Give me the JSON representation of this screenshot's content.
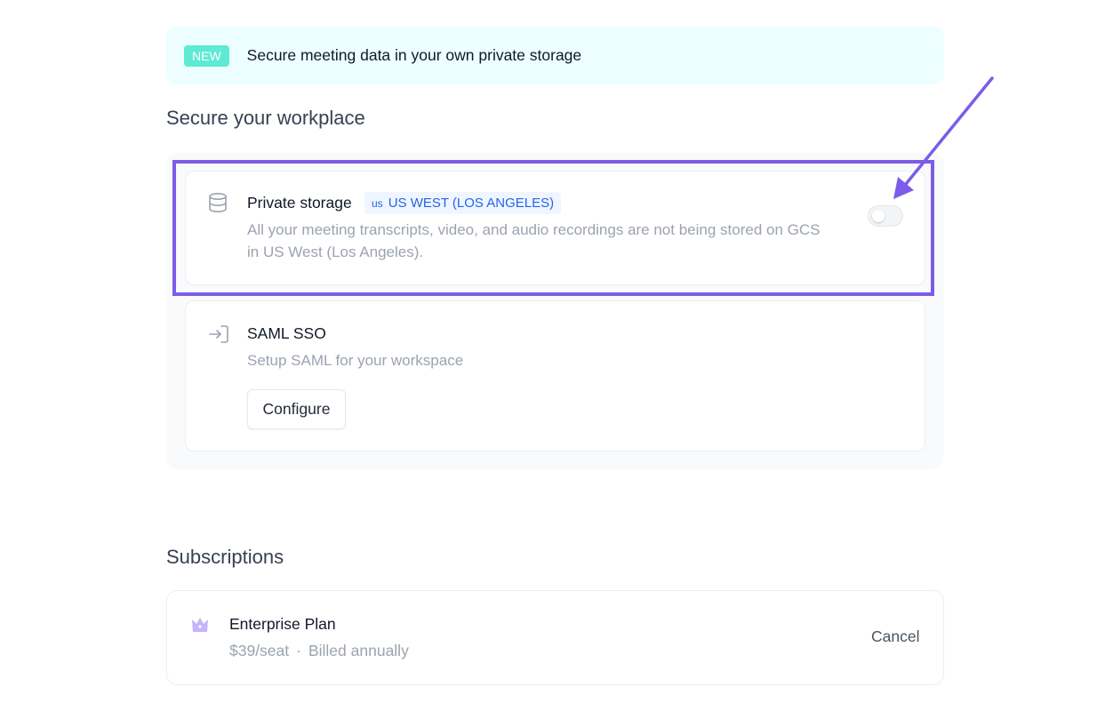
{
  "banner": {
    "badge": "NEW",
    "text": "Secure meeting data in your own private storage"
  },
  "security": {
    "title": "Secure your workplace",
    "private_storage": {
      "icon": "database-icon",
      "title": "Private storage",
      "region_code": "us",
      "region": "US WEST (LOS ANGELES)",
      "description": "All your meeting transcripts, video, and audio recordings are not being stored on GCS in US West (Los Angeles).",
      "toggle_on": false
    },
    "saml": {
      "icon": "sign-in-icon",
      "title": "SAML SSO",
      "description": "Setup SAML for your workspace",
      "button": "Configure"
    }
  },
  "subscriptions": {
    "title": "Subscriptions",
    "plan": {
      "icon": "crown-icon",
      "name": "Enterprise Plan",
      "price": "$39/seat",
      "separator": "·",
      "billing": "Billed annually",
      "cancel": "Cancel"
    }
  },
  "annotation": {
    "highlight_color": "#7c5ce8"
  }
}
